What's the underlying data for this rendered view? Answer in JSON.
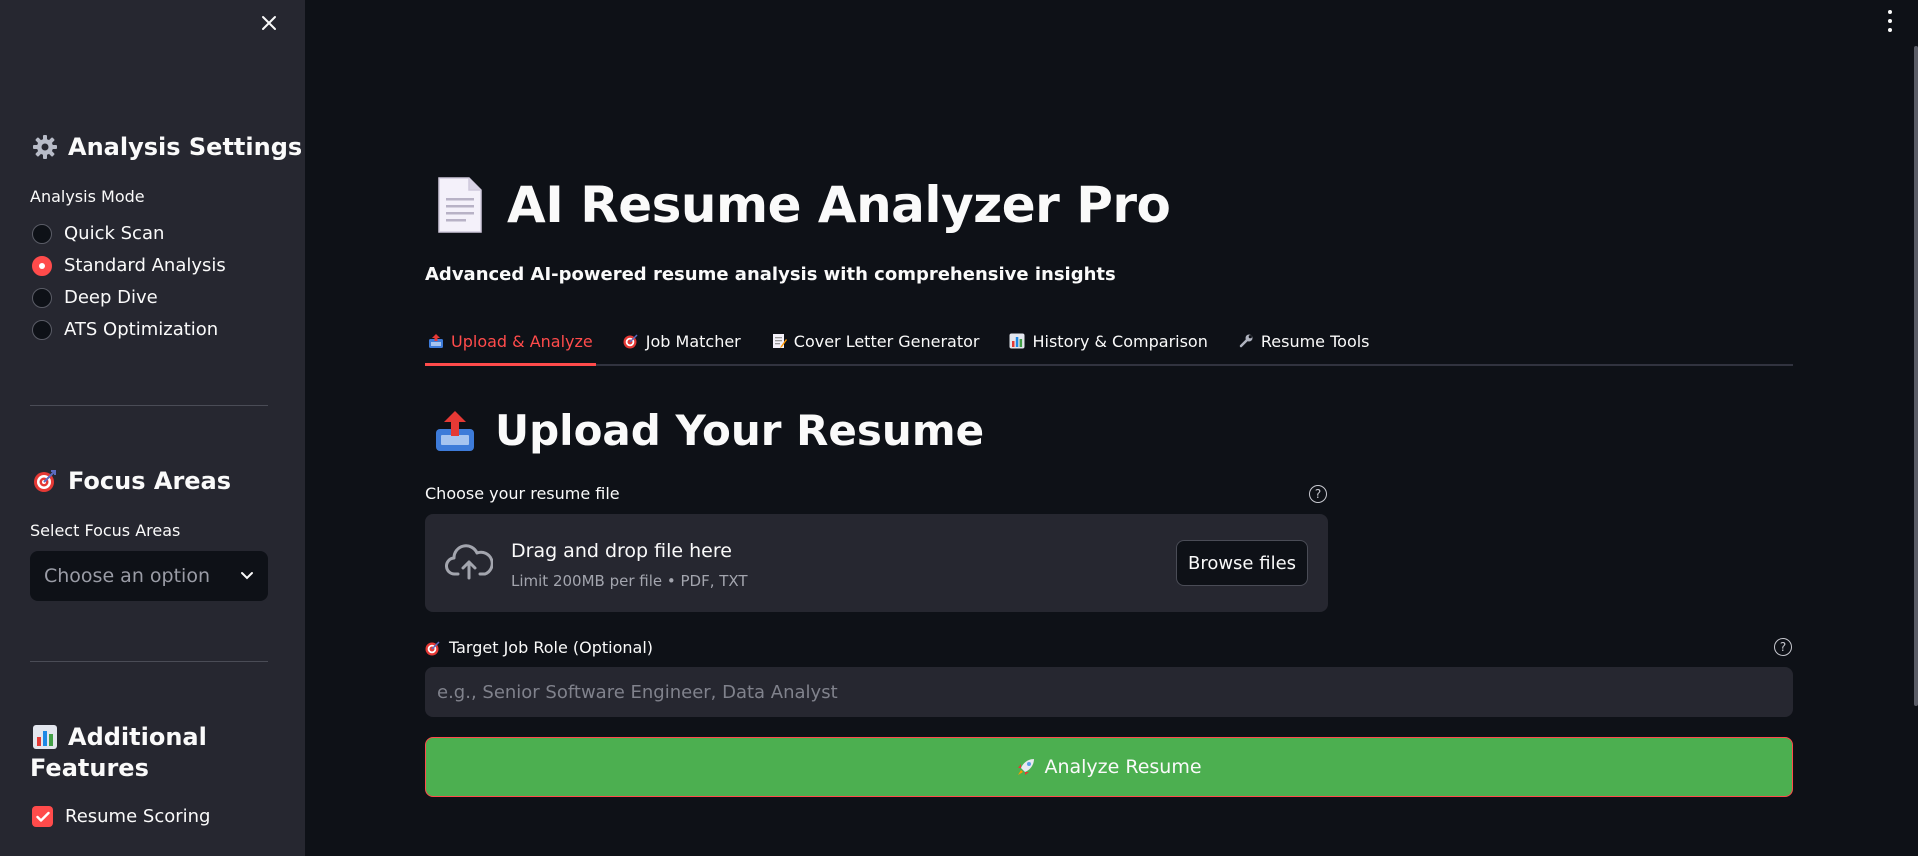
{
  "sidebar": {
    "analysis_settings": {
      "icon": "gear-icon",
      "title": "Analysis Settings"
    },
    "analysis_mode_label": "Analysis Mode",
    "modes": [
      {
        "label": "Quick Scan",
        "selected": false
      },
      {
        "label": "Standard Analysis",
        "selected": true
      },
      {
        "label": "Deep Dive",
        "selected": false
      },
      {
        "label": "ATS Optimization",
        "selected": false
      }
    ],
    "focus_areas": {
      "icon": "target-icon",
      "title": "Focus Areas"
    },
    "select_focus_label": "Select Focus Areas",
    "select_placeholder": "Choose an option",
    "additional_features": {
      "icon": "bar-chart-icon",
      "title_line1": "Additional",
      "title_line2": "Features"
    },
    "checkbox_resume_scoring": {
      "label": "Resume Scoring",
      "checked": true
    }
  },
  "main": {
    "title_icon": "document-icon",
    "title": "AI Resume Analyzer Pro",
    "subtitle": "Advanced AI-powered resume analysis with comprehensive insights",
    "tabs": [
      {
        "icon": "inbox-upload-icon",
        "label": "Upload & Analyze",
        "active": true
      },
      {
        "icon": "target-icon",
        "label": "Job Matcher",
        "active": false
      },
      {
        "icon": "memo-icon",
        "label": "Cover Letter Generator",
        "active": false
      },
      {
        "icon": "bar-chart-icon",
        "label": "History & Comparison",
        "active": false
      },
      {
        "icon": "wrench-icon",
        "label": "Resume Tools",
        "active": false
      }
    ],
    "upload_heading": "Upload Your Resume",
    "upload_heading_icon": "outbox-tray-icon",
    "file_label": "Choose your resume file",
    "dropzone": {
      "title": "Drag and drop file here",
      "subtitle": "Limit 200MB per file • PDF, TXT",
      "browse_label": "Browse files"
    },
    "job_role_label": "Target Job Role (Optional)",
    "job_role_placeholder": "e.g., Senior Software Engineer, Data Analyst",
    "job_role_value": "",
    "analyze_button_label": "Analyze Resume"
  },
  "colors": {
    "accent": "#ff4b4b",
    "analyze_green": "#4caf50",
    "sidebar_bg": "#262730",
    "main_bg": "#0e1117"
  }
}
